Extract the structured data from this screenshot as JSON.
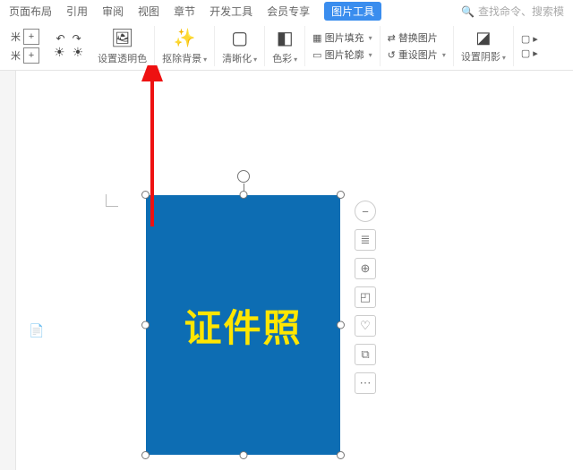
{
  "tabs": {
    "layout": "页面布局",
    "reference": "引用",
    "review": "审阅",
    "view": "视图",
    "section": "章节",
    "devtools": "开发工具",
    "vip": "会员专享",
    "picture_tools": "图片工具"
  },
  "search": {
    "placeholder": "查找命令、搜索模"
  },
  "ribbon": {
    "unit": "米",
    "set_transparent": "设置透明色",
    "remove_bg": "抠除背景",
    "sharpen": "清晰化",
    "color": "色彩",
    "fill": "图片填充",
    "outline": "图片轮廓",
    "replace": "替换图片",
    "reset": "重设图片",
    "shadow": "设置阴影"
  },
  "image": {
    "label": "证件照"
  },
  "side": {
    "collapse": "−",
    "layout": "≣",
    "zoom": "⊕",
    "crop": "◰",
    "idea": "♡",
    "copy": "⧉",
    "more": "⋯"
  }
}
